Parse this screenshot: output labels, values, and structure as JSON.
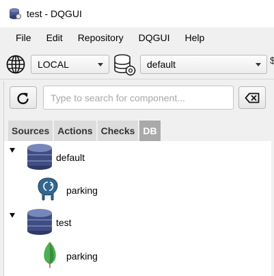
{
  "window": {
    "title": "test - DQGUI"
  },
  "menu": [
    "File",
    "Edit",
    "Repository",
    "DQGUI",
    "Help"
  ],
  "toolbar": {
    "environment": "LOCAL",
    "database": "default",
    "edge_glyph": "$"
  },
  "search": {
    "placeholder": "Type to search for component..."
  },
  "tabs": [
    {
      "label": "Sources",
      "active": false
    },
    {
      "label": "Actions",
      "active": false
    },
    {
      "label": "Checks",
      "active": false
    },
    {
      "label": "DB",
      "active": true
    }
  ],
  "tree": [
    {
      "name": "default",
      "icon": "database-icon",
      "expanded": true,
      "children": [
        {
          "name": "parking",
          "icon": "postgresql-elephant-icon"
        }
      ]
    },
    {
      "name": "test",
      "icon": "database-icon",
      "expanded": true,
      "children": [
        {
          "name": "parking",
          "icon": "mongodb-leaf-icon"
        }
      ]
    }
  ],
  "colors": {
    "active_tab": "#a9a9a9",
    "inactive_tab": "#dcdcdc",
    "postgres_blue": "#336791",
    "mongo_green": "#4caf50"
  }
}
